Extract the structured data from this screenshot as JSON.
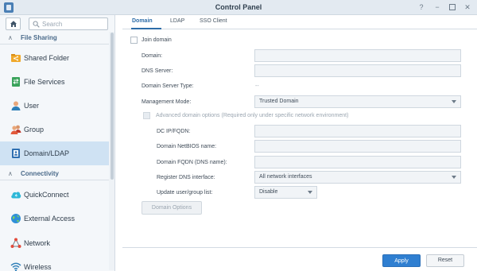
{
  "window": {
    "title": "Control Panel",
    "buttons": [
      "help-icon",
      "minimize-icon",
      "maximize-icon",
      "close-icon"
    ]
  },
  "sidebar": {
    "search_placeholder": "Search",
    "sections": [
      {
        "label": "File Sharing",
        "items": [
          {
            "label": "Shared Folder",
            "icon": "shared-folder-icon"
          },
          {
            "label": "File Services",
            "icon": "file-services-icon"
          },
          {
            "label": "User",
            "icon": "user-icon"
          },
          {
            "label": "Group",
            "icon": "group-icon"
          },
          {
            "label": "Domain/LDAP",
            "icon": "domain-ldap-icon",
            "selected": true
          }
        ]
      },
      {
        "label": "Connectivity",
        "items": [
          {
            "label": "QuickConnect",
            "icon": "quickconnect-icon"
          },
          {
            "label": "External Access",
            "icon": "external-access-icon"
          },
          {
            "label": "Network",
            "icon": "network-icon"
          },
          {
            "label": "Wireless",
            "icon": "wireless-icon"
          }
        ]
      }
    ]
  },
  "tabs": [
    {
      "label": "Domain",
      "active": true
    },
    {
      "label": "LDAP"
    },
    {
      "label": "SSO Client"
    }
  ],
  "form": {
    "join_domain": {
      "label": "Join domain",
      "checked": false
    },
    "domain": {
      "label": "Domain:",
      "value": ""
    },
    "dns_server": {
      "label": "DNS Server:",
      "value": ""
    },
    "domain_server_type": {
      "label": "Domain Server Type:",
      "value": "--"
    },
    "management_mode": {
      "label": "Management Mode:",
      "value": "Trusted Domain"
    },
    "advanced": {
      "label": "Advanced domain options (Required only under specific network environment)",
      "checked": false
    },
    "dc_ip": {
      "label": "DC IP/FQDN:",
      "value": ""
    },
    "netbios": {
      "label": "Domain NetBIOS name:",
      "value": ""
    },
    "fqdn": {
      "label": "Domain FQDN (DNS name):",
      "value": ""
    },
    "register_dns": {
      "label": "Register DNS interface:",
      "value": "All network interfaces"
    },
    "update_list": {
      "label": "Update user/group list:",
      "value": "Disable"
    },
    "domain_options_button": "Domain Options"
  },
  "footer": {
    "apply": "Apply",
    "reset": "Reset"
  },
  "colors": {
    "accent": "#2f7fd1",
    "selected_row": "#cfe2f3",
    "section_text": "#4a6a8a"
  }
}
